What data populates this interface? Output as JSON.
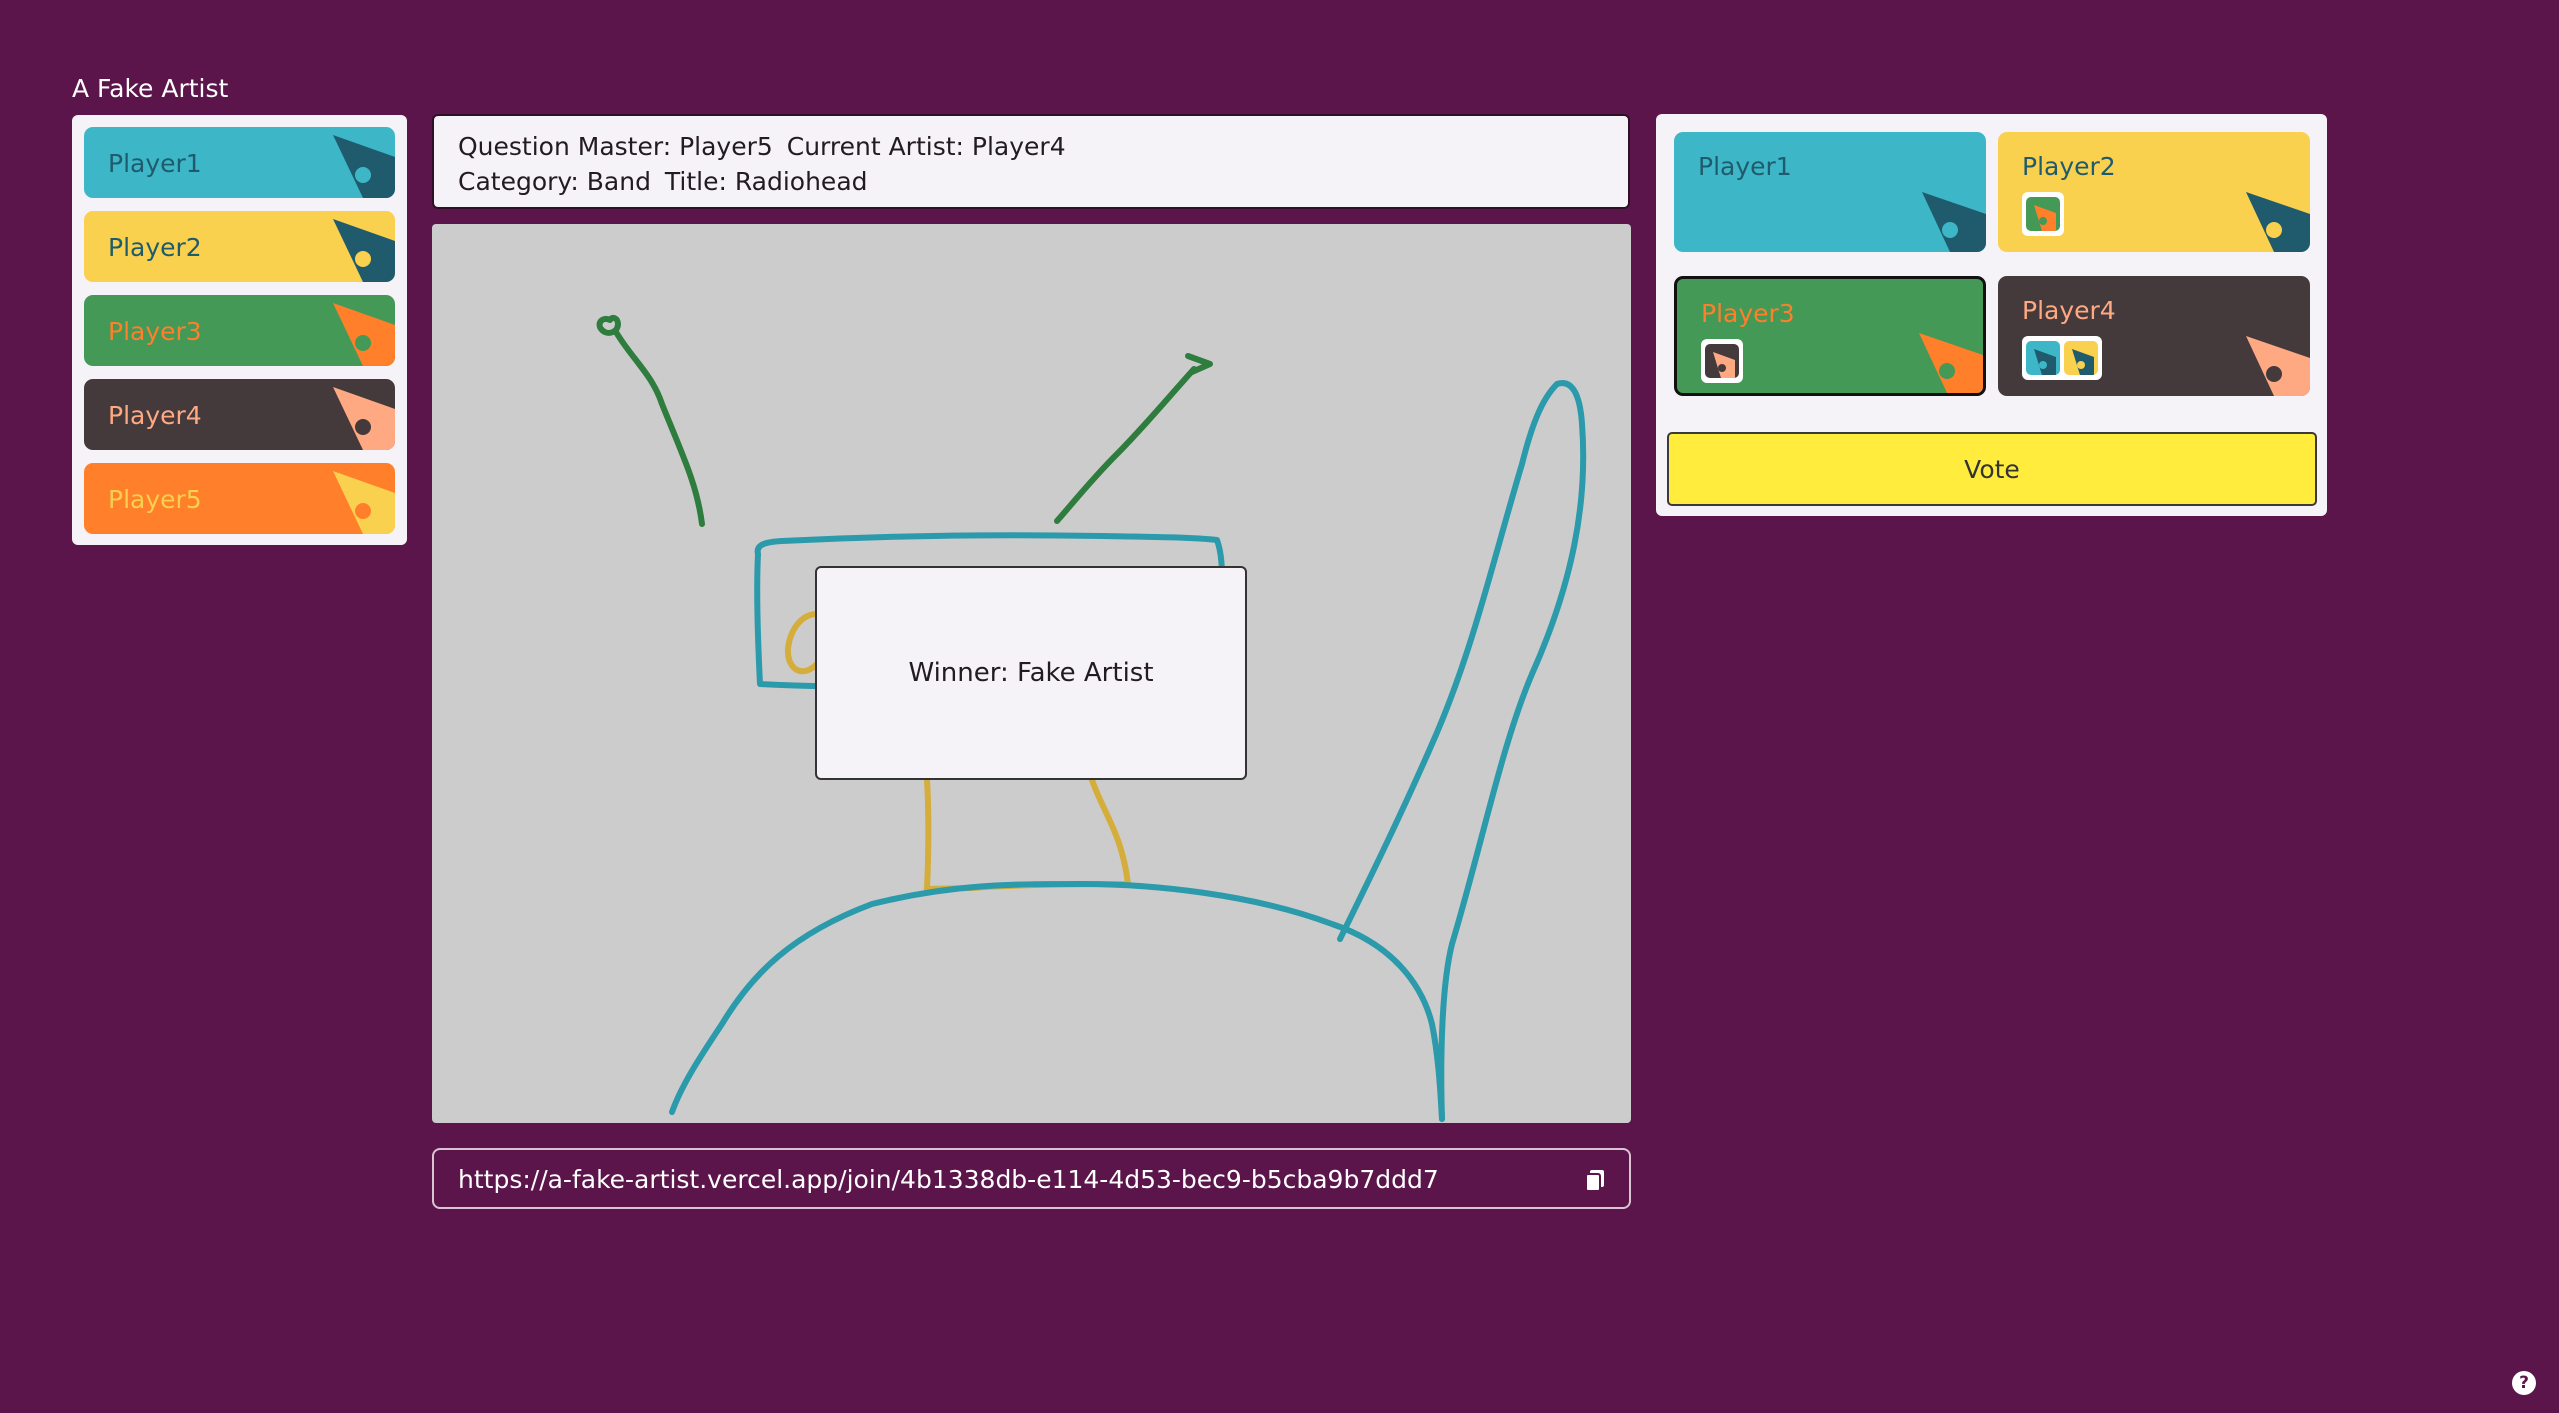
{
  "app": {
    "title": "A Fake Artist"
  },
  "players": [
    {
      "name": "Player1",
      "bg": "#3db7c7",
      "text": "#1f5b6c",
      "pen": "#1f5b6c",
      "dot": "#3db7c7"
    },
    {
      "name": "Player2",
      "bg": "#fad04f",
      "text": "#1f5b6c",
      "pen": "#1f5b6c",
      "dot": "#fad04f"
    },
    {
      "name": "Player3",
      "bg": "#449956",
      "text": "#ff7f2a",
      "pen": "#ff7f2a",
      "dot": "#449956"
    },
    {
      "name": "Player4",
      "bg": "#443a3c",
      "text": "#ffa982",
      "pen": "#ffa982",
      "dot": "#443a3c"
    },
    {
      "name": "Player5",
      "bg": "#ff7f2a",
      "text": "#fad04f",
      "pen": "#fad04f",
      "dot": "#ff7f2a"
    }
  ],
  "round": {
    "qm_label": "Question Master: Player5",
    "artist_label": "Current Artist: Player4",
    "category_label": "Category: Band",
    "title_label": "Title: Radiohead"
  },
  "canvas": {
    "background": "#cccccc",
    "stroke_colors": {
      "green": "#2e7d3e",
      "teal": "#2b9aab",
      "yellow": "#d4ad3a"
    }
  },
  "result": {
    "winner_text": "Winner: Fake Artist"
  },
  "invite": {
    "url": "https://a-fake-artist.vercel.app/join/4b1338db-e114-4d53-bec9-b5cba9b7ddd7",
    "copy_icon": "copy-icon"
  },
  "vote": {
    "button_label": "Vote",
    "cards": [
      {
        "name": "Player1",
        "bg": "#3db7c7",
        "text": "#1f5b6c",
        "pen": "#1f5b6c",
        "dot": "#3db7c7",
        "selected": false,
        "voted_by": []
      },
      {
        "name": "Player2",
        "bg": "#fad04f",
        "text": "#1f5b6c",
        "pen": "#1f5b6c",
        "dot": "#fad04f",
        "selected": false,
        "voted_by": [
          "Player3"
        ]
      },
      {
        "name": "Player3",
        "bg": "#449956",
        "text": "#ff7f2a",
        "pen": "#ff7f2a",
        "dot": "#449956",
        "selected": true,
        "voted_by": [
          "Player4"
        ]
      },
      {
        "name": "Player4",
        "bg": "#443a3c",
        "text": "#ffa982",
        "pen": "#ffa982",
        "dot": "#443a3c",
        "selected": false,
        "voted_by": [
          "Player1",
          "Player2"
        ]
      }
    ]
  },
  "help": {
    "label": "?"
  }
}
